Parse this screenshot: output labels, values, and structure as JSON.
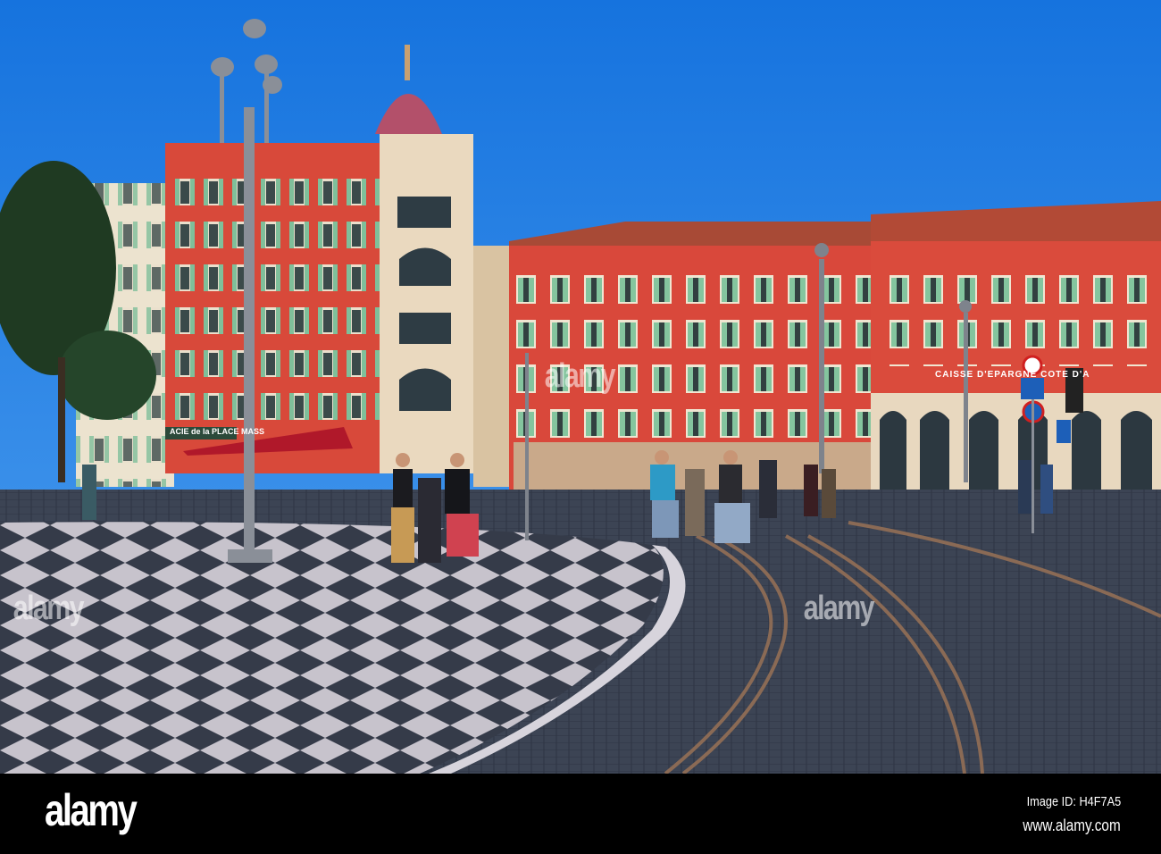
{
  "footer": {
    "logo": "alamy",
    "image_id": "Image ID: H4F7A5",
    "url": "www.alamy.com"
  },
  "watermark": "alamy",
  "signs": {
    "bank": "CAISSE D'EPARGNE COTE D'A",
    "pharmacy": "ACIE de la PLACE MASS"
  },
  "colors": {
    "sky": "#1f7fe3",
    "facade": "#d9503c",
    "shutters": "#8fc7a8",
    "paving_dark": "#3a4150",
    "paving_light": "#c9c6cf"
  }
}
